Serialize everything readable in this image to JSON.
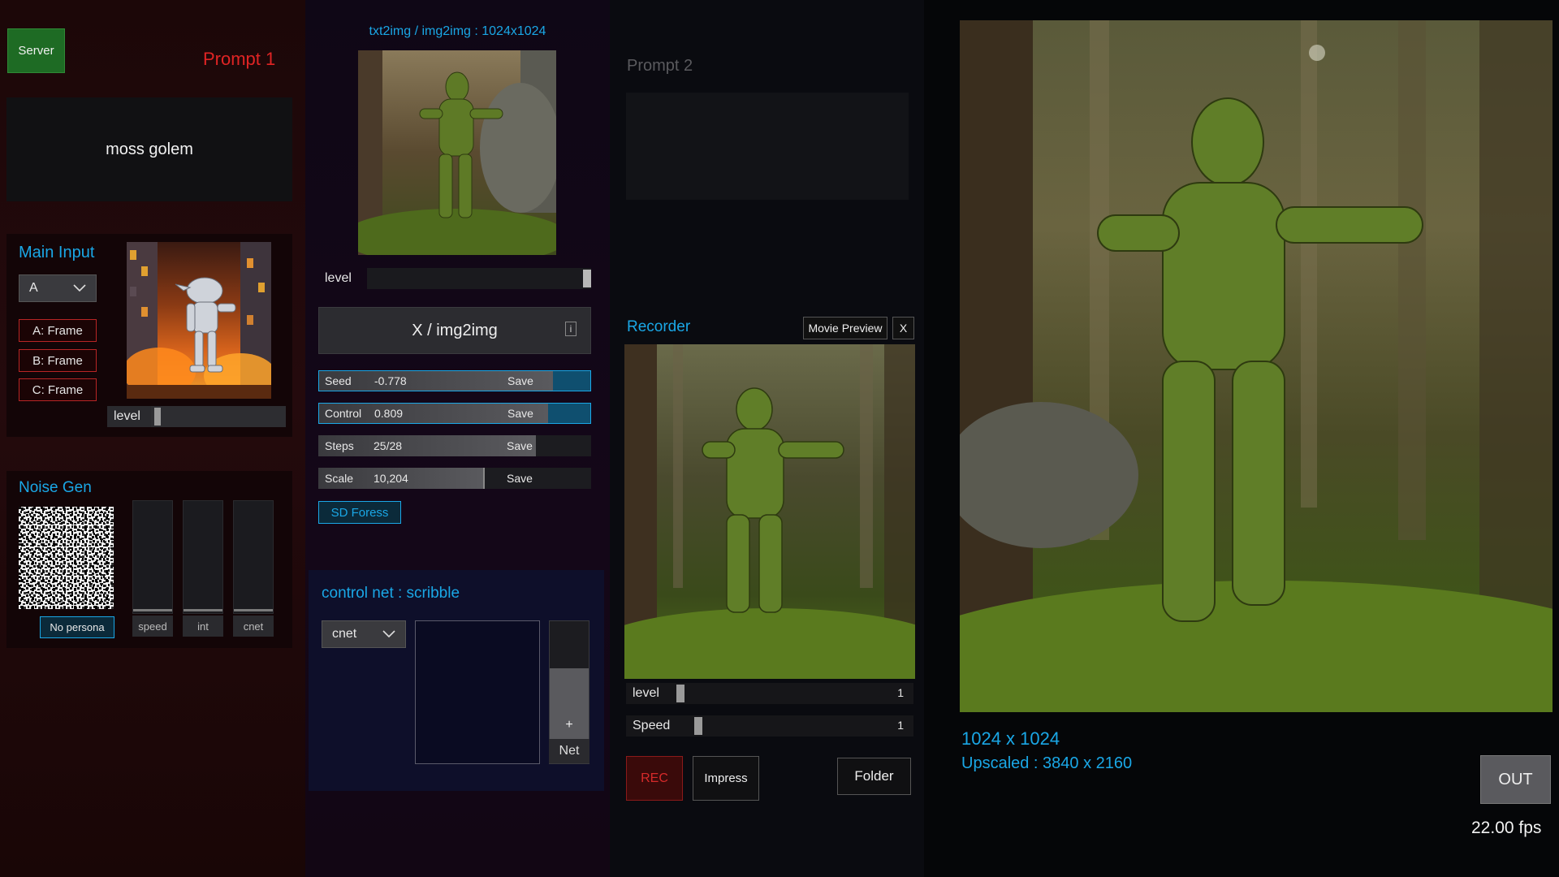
{
  "left": {
    "server_button": "Server",
    "prompt1_label": "Prompt 1",
    "prompt1_text": "moss golem",
    "main_input": {
      "title": "Main Input",
      "select_value": "A",
      "frames": [
        "A: Frame",
        "B: Frame",
        "C: Frame"
      ],
      "level_label": "level",
      "level_value": 0.05
    },
    "noise_gen": {
      "title": "Noise Gen",
      "persona_button": "No persona",
      "sliders": [
        {
          "label": "speed",
          "value": 0.0
        },
        {
          "label": "int",
          "value": 0.0
        },
        {
          "label": "cnet",
          "value": 0.0
        }
      ]
    }
  },
  "middle": {
    "resolution_title": "txt2img / img2img : 1024x1024",
    "level_label": "level",
    "level_value": 0.98,
    "mode_button": "X / img2img",
    "info_icon": "i",
    "params": [
      {
        "label": "Seed",
        "value": "-0.778",
        "save": "Save",
        "fill": 0.85,
        "active": true
      },
      {
        "label": "Control",
        "value": "0.809",
        "save": "Save",
        "fill": 0.83,
        "active": true
      },
      {
        "label": "Steps",
        "value": "25/28",
        "save": "Save",
        "fill": 0.79,
        "active": false
      },
      {
        "label": "Scale",
        "value": "10,204",
        "save": "Save",
        "fill": 0.6,
        "active": false
      }
    ],
    "sd_button": "SD Foress",
    "control_net": {
      "title": "control net : scribble",
      "select_value": "cnet",
      "plus": "+",
      "net_label": "Net"
    }
  },
  "right": {
    "prompt2_label": "Prompt 2",
    "recorder": {
      "title": "Recorder",
      "movie_preview": "Movie Preview",
      "close": "X",
      "level_label": "level",
      "level_value": "1",
      "speed_label": "Speed",
      "speed_value": "1",
      "rec_button": "REC",
      "impress_button": "Impress",
      "folder_button": "Folder"
    }
  },
  "output": {
    "resolution": "1024 x 1024",
    "upscaled": "Upscaled : 3840 x 2160",
    "out_button": "OUT",
    "fps": "22.00 fps"
  },
  "colors": {
    "accent": "#1aa7e6",
    "prompt1": "#e02424",
    "rec": "#d62a2a",
    "server": "#1e6b24"
  }
}
